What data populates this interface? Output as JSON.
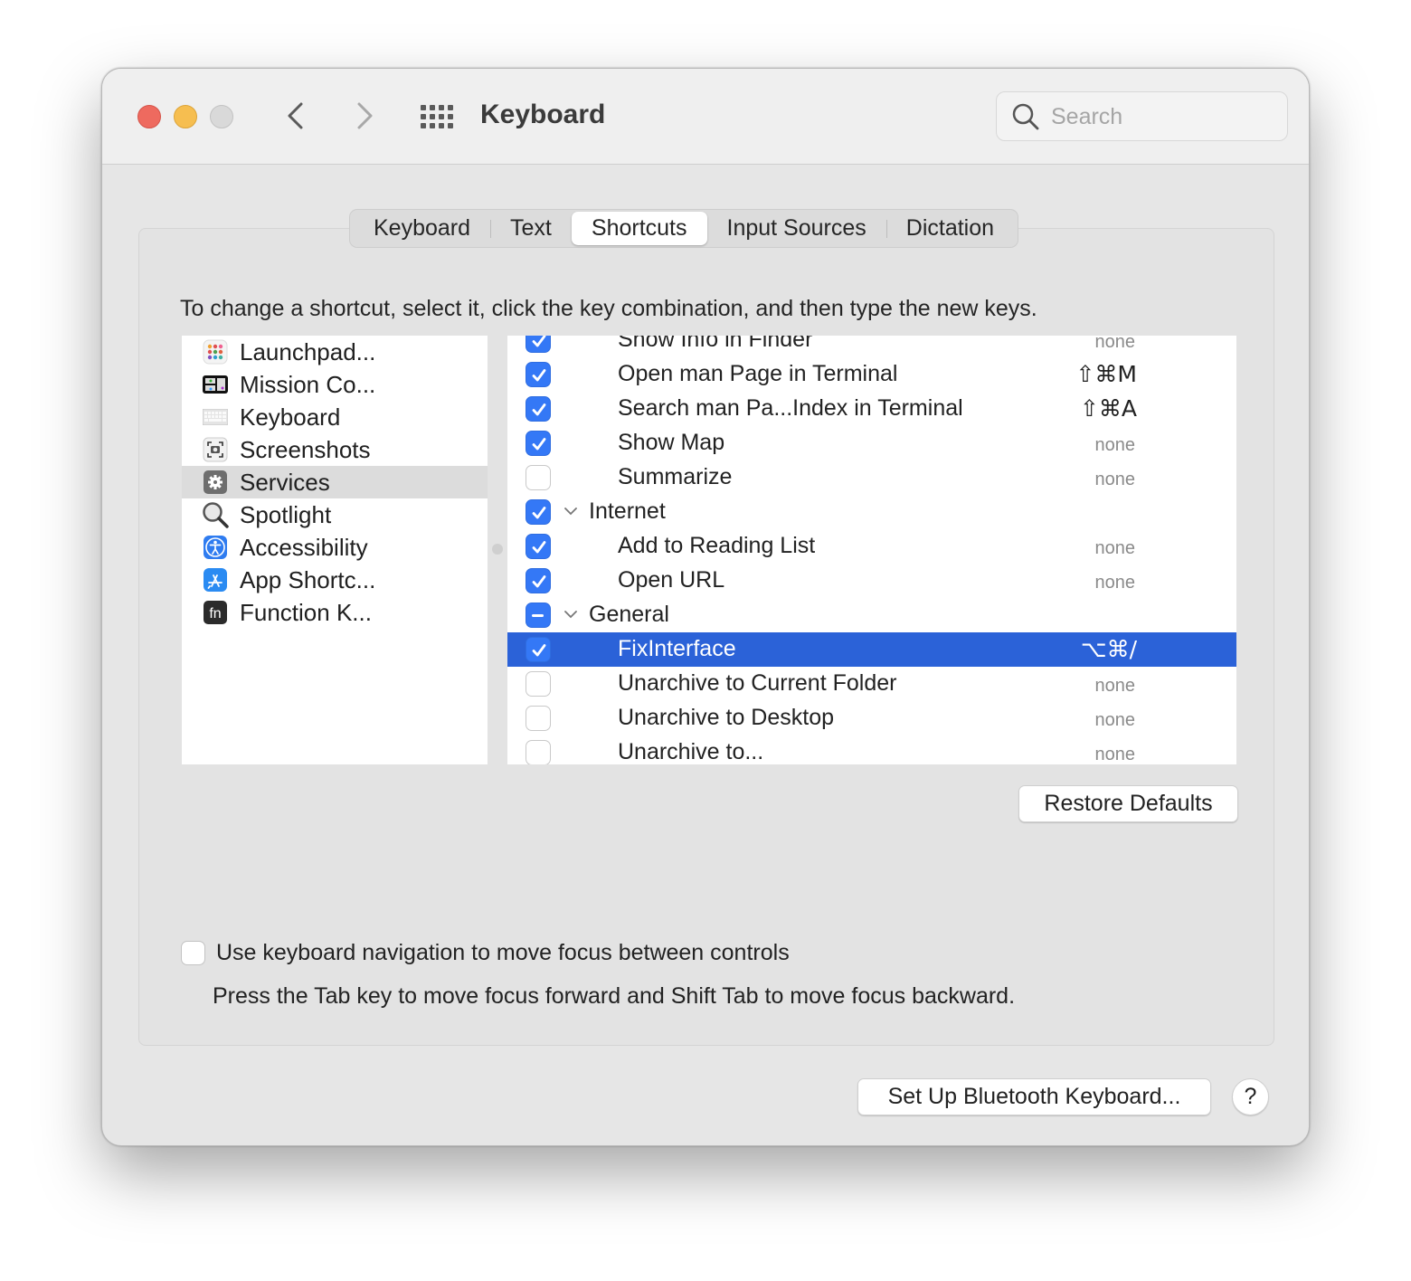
{
  "window": {
    "title": "Keyboard",
    "search_placeholder": "Search"
  },
  "tabs": [
    {
      "label": "Keyboard",
      "active": false
    },
    {
      "label": "Text",
      "active": false
    },
    {
      "label": "Shortcuts",
      "active": true
    },
    {
      "label": "Input Sources",
      "active": false
    },
    {
      "label": "Dictation",
      "active": false
    }
  ],
  "instructions": "To change a shortcut, select it, click the key combination, and then type the new keys.",
  "categories": [
    {
      "label": "Launchpad...",
      "icon": "launchpad-icon"
    },
    {
      "label": "Mission Co...",
      "icon": "mission-control-icon"
    },
    {
      "label": "Keyboard",
      "icon": "keyboard-icon"
    },
    {
      "label": "Screenshots",
      "icon": "screenshots-icon"
    },
    {
      "label": "Services",
      "icon": "gear-icon",
      "selected": true
    },
    {
      "label": "Spotlight",
      "icon": "magnifier-icon"
    },
    {
      "label": "Accessibility",
      "icon": "accessibility-icon"
    },
    {
      "label": "App Shortc...",
      "icon": "app-store-icon"
    },
    {
      "label": "Function K...",
      "icon": "fn-key-icon"
    }
  ],
  "shortcuts": [
    {
      "label": "Show Info in Finder",
      "state": "on",
      "shortcut": "none",
      "group": false
    },
    {
      "label": "Open man Page in Terminal",
      "state": "on",
      "shortcut": "⇧⌘M",
      "group": false
    },
    {
      "label": "Search man Pa...Index in Terminal",
      "state": "on",
      "shortcut": "⇧⌘A",
      "group": false
    },
    {
      "label": "Show Map",
      "state": "on",
      "shortcut": "none",
      "group": false
    },
    {
      "label": "Summarize",
      "state": "off",
      "shortcut": "none",
      "group": false
    },
    {
      "label": "Internet",
      "state": "on",
      "shortcut": "",
      "group": true
    },
    {
      "label": "Add to Reading List",
      "state": "on",
      "shortcut": "none",
      "group": false
    },
    {
      "label": "Open URL",
      "state": "on",
      "shortcut": "none",
      "group": false
    },
    {
      "label": "General",
      "state": "mixed",
      "shortcut": "",
      "group": true
    },
    {
      "label": "FixInterface",
      "state": "on",
      "shortcut": "⌥⌘/",
      "group": false,
      "selected": true
    },
    {
      "label": "Unarchive to Current Folder",
      "state": "off",
      "shortcut": "none",
      "group": false
    },
    {
      "label": "Unarchive to Desktop",
      "state": "off",
      "shortcut": "none",
      "group": false
    },
    {
      "label": "Unarchive to...",
      "state": "off",
      "shortcut": "none",
      "group": false
    }
  ],
  "buttons": {
    "restore_defaults": "Restore Defaults",
    "bluetooth": "Set Up Bluetooth Keyboard...",
    "help": "?"
  },
  "keyboard_navigation": {
    "label": "Use keyboard navigation to move focus between controls",
    "checked": false,
    "hint": "Press the Tab key to move focus forward and Shift Tab to move focus backward."
  },
  "colors": {
    "accent": "#3478f6",
    "selection": "#2b62d8",
    "close": "#ee6a5f",
    "minimize": "#f6be50",
    "zoom": "#d9d9d9"
  }
}
